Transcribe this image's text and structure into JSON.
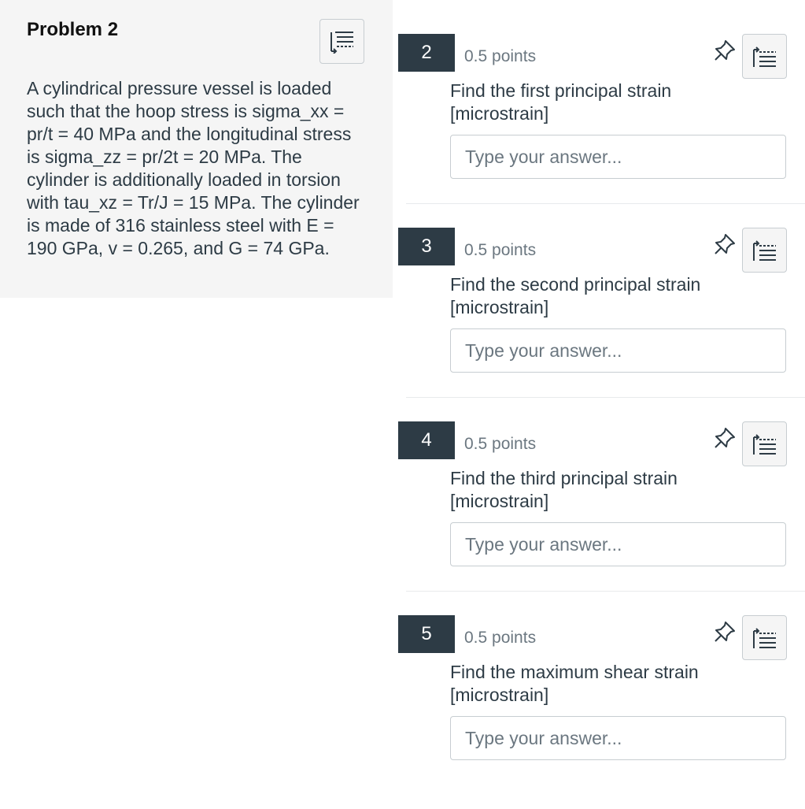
{
  "passage": {
    "title": "Problem 2",
    "body": "A cylindrical pressure vessel is loaded such that the hoop stress is sigma_xx = pr/t = 40 MPa and the longitudinal stress is sigma_zz = pr/2t = 20 MPa.  The cylinder is additionally loaded in torsion with tau_xz = Tr/J = 15 MPa.  The cylinder is made of 316 stainless steel with E = 190 GPa, v = 0.265, and G = 74 GPa.",
    "collapse_icon": "line-reader-icon"
  },
  "questions": [
    {
      "number": "2",
      "points": "0.5 points",
      "prompt": "Find the first principal strain [microstrain]",
      "placeholder": "Type your answer..."
    },
    {
      "number": "3",
      "points": "0.5 points",
      "prompt": "Find the second principal strain [microstrain]",
      "placeholder": "Type your answer..."
    },
    {
      "number": "4",
      "points": "0.5 points",
      "prompt": "Find the third principal strain [microstrain]",
      "placeholder": "Type your answer..."
    },
    {
      "number": "5",
      "points": "0.5 points",
      "prompt": "Find the maximum shear strain [microstrain]",
      "placeholder": "Type your answer..."
    }
  ],
  "colors": {
    "number_badge": "#2d3b45",
    "panel_bg": "#f5f5f5",
    "text": "#2d3b45",
    "muted": "#6b7780",
    "border": "#c7cdd1"
  },
  "icons": {
    "pin": "pin-icon",
    "line_reader": "line-reader-icon"
  }
}
